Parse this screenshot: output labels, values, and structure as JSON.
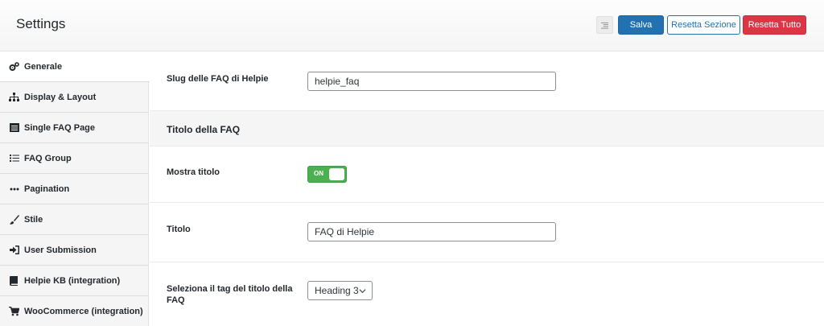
{
  "header": {
    "title": "Settings",
    "save_label": "Salva",
    "reset_section_label": "Resetta Sezione",
    "reset_all_label": "Resetta Tutto"
  },
  "sidebar": {
    "items": [
      {
        "label": "Generale",
        "icon": "cogs-icon",
        "active": true
      },
      {
        "label": "Display & Layout",
        "icon": "sitemap-icon"
      },
      {
        "label": "Single FAQ Page",
        "icon": "page-icon"
      },
      {
        "label": "FAQ Group",
        "icon": "list-icon"
      },
      {
        "label": "Pagination",
        "icon": "ellipsis-icon"
      },
      {
        "label": "Stile",
        "icon": "paintbrush-icon"
      },
      {
        "label": "User Submission",
        "icon": "sign-in-icon"
      },
      {
        "label": "Helpie KB (integration)",
        "icon": "book-icon"
      },
      {
        "label": "WooCommerce (integration)",
        "icon": "cart-icon"
      }
    ]
  },
  "main": {
    "slug": {
      "label": "Slug delle FAQ di Helpie",
      "value": "helpie_faq"
    },
    "section_title": "Titolo della FAQ",
    "show_title": {
      "label": "Mostra titolo",
      "toggle_text": "ON",
      "enabled": true
    },
    "title": {
      "label": "Titolo",
      "value": "FAQ di Helpie"
    },
    "title_tag": {
      "label": "Seleziona il tag del titolo della FAQ",
      "selected": "Heading 3"
    }
  },
  "colors": {
    "primary": "#2271b1",
    "danger": "#dc3545",
    "toggle_on": "#4caf50"
  }
}
